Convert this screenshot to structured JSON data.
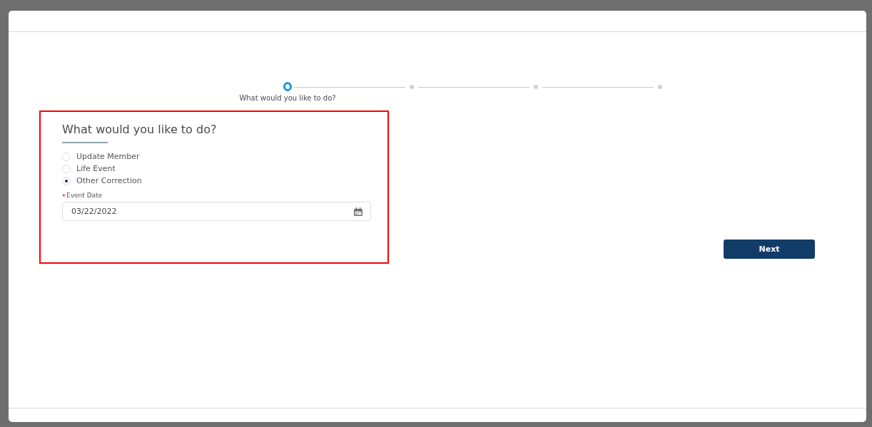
{
  "progress": {
    "steps": [
      {
        "label": "What would you like to do?",
        "current": true
      },
      {
        "current": false
      },
      {
        "current": false
      },
      {
        "current": false
      }
    ]
  },
  "form": {
    "highlighted": true,
    "title": "What would you like to do?",
    "options": [
      {
        "label": "Update Member",
        "selected": false
      },
      {
        "label": "Life Event",
        "selected": false
      },
      {
        "label": "Other Correction",
        "selected": true
      }
    ],
    "event_date": {
      "label": "Event Date",
      "required": true,
      "value": "03/22/2022"
    }
  },
  "buttons": [
    {
      "label": "Next"
    }
  ]
}
